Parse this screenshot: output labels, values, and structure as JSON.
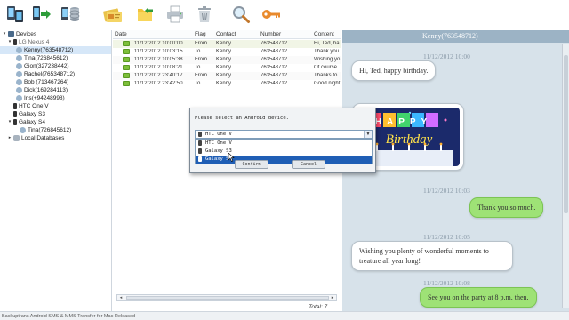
{
  "toolbar": {
    "buttons": [
      {
        "name": "backup-icon"
      },
      {
        "name": "transfer-icon"
      },
      {
        "name": "database-icon"
      },
      {
        "name": "card-icon"
      },
      {
        "name": "export-icon"
      },
      {
        "name": "print-icon"
      },
      {
        "name": "delete-icon"
      },
      {
        "name": "search-icon"
      },
      {
        "name": "key-icon"
      }
    ]
  },
  "tree": {
    "devices_label": "Devices",
    "root_device": "LG Nexus 4",
    "contacts": [
      "Kenny(763548712)",
      "Tina(726845612)",
      "Gion(327238442)",
      "Rachel(765348712)",
      "Bob (713467264)",
      "Dick(169284113)",
      "Iris(+94248998)"
    ],
    "other_devices": [
      "HTC One V",
      "Galaxy S3"
    ],
    "galaxy_s4": "Galaxy S4",
    "galaxy_s4_contact": "Tina(726845612)",
    "local_databases": "Local Databases"
  },
  "table": {
    "headers": [
      "Date",
      "Flag",
      "Contact",
      "Number",
      "Content"
    ],
    "rows": [
      [
        "11/12/2012 10:00:00",
        "From",
        "Kenny",
        "763548712",
        "Hi, Ted, ha"
      ],
      [
        "11/12/2012 10:03:15",
        "To",
        "Kenny",
        "763548712",
        "Thank you"
      ],
      [
        "11/12/2012 10:05:38",
        "From",
        "Kenny",
        "763548712",
        "Wishing yo"
      ],
      [
        "11/12/2012 10:08:21",
        "To",
        "Kenny",
        "763548712",
        "Of course"
      ],
      [
        "11/12/2012 23:40:17",
        "From",
        "Kenny",
        "763548712",
        "Thanks fo"
      ],
      [
        "11/12/2012 23:42:50",
        "To",
        "Kenny",
        "763548712",
        "Good night"
      ]
    ],
    "total": "Total: 7"
  },
  "chat": {
    "title": "Kenny(763548712)",
    "time1": "11/12/2012 10:00",
    "msg1": "Hi, Ted, happy birthday.",
    "time2": "11/12/2012 10:03",
    "msg2": "Thank you so much.",
    "time3": "11/12/2012 10:05",
    "msg3_line1": "Wishing you plenty of wonderful moments to",
    "msg3_line2": "treature all year long!",
    "time4": "11/12/2012 10:08",
    "msg4": "See you on the party at 8 p.m. then.",
    "photo_text1": "HAPPY",
    "photo_text2": "Birthday"
  },
  "dialog": {
    "title": "Please select an Android device.",
    "selected": "HTC One V",
    "options": [
      "HTC One V",
      "Galaxy S3",
      "Galaxy S4"
    ],
    "confirm": "Confirm",
    "cancel": "Cancel"
  },
  "statusbar": {
    "text": "Backuptrans Android SMS & MMS Transfer for Mac Released"
  },
  "colors": {
    "accent": "#1f5eb5",
    "chat_bg": "#d7e2ea",
    "outgoing": "#9ee276",
    "title_bar": "#9cb3c5"
  }
}
